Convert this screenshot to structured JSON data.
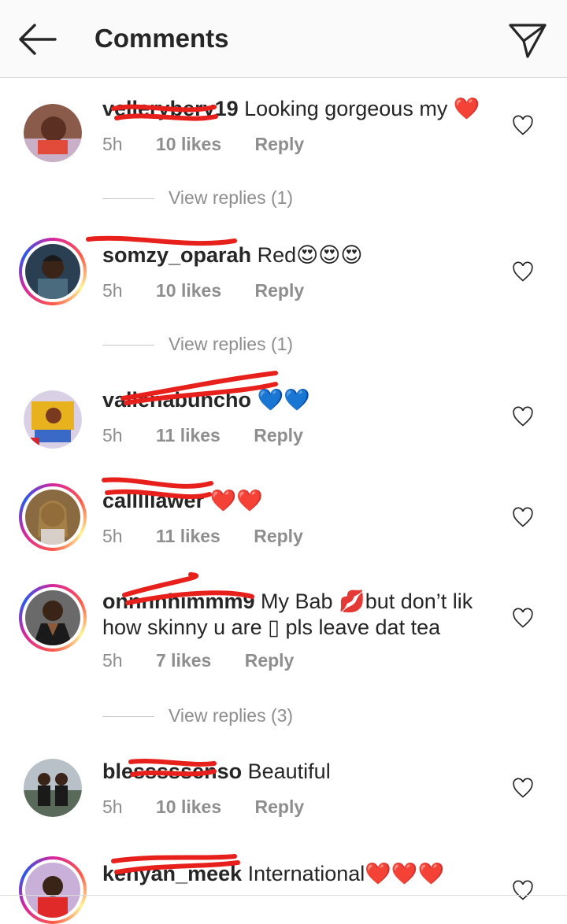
{
  "header": {
    "title": "Comments",
    "icons": {
      "back": "back-arrow-icon",
      "share": "direct-message-icon"
    }
  },
  "comments": [
    {
      "username": "vellerybery19",
      "text": "Looking gorgeous my",
      "emoji": "❤️",
      "time": "5h",
      "likes": "10 likes",
      "reply": "Reply",
      "view_replies": "View replies (1)",
      "story_ring": false
    },
    {
      "username": "somzy_oparah",
      "text": "Red",
      "emoji": "😍😍😍",
      "time": "5h",
      "likes": "10 likes",
      "reply": "Reply",
      "view_replies": "View replies (1)",
      "story_ring": true
    },
    {
      "username": "vallenabuncho",
      "text": "",
      "emoji": "💙💙",
      "time": "5h",
      "likes": "11 likes",
      "reply": "Reply",
      "story_ring": false
    },
    {
      "username": "calllllawer",
      "text": "",
      "emoji": "❤️❤️",
      "time": "5h",
      "likes": "11 likes",
      "reply": "Reply",
      "story_ring": true
    },
    {
      "username": "onnnnhimmm9",
      "text_line1": "My Bab",
      "emoji": "💋",
      "text_line1b": "but don’t lik",
      "text_line2": "how skinny u are ▯ pls leave dat tea",
      "time": "5h",
      "likes": "7 likes",
      "reply": "Reply",
      "view_replies": "View replies (3)",
      "story_ring": true
    },
    {
      "username": "blesssssenso",
      "text": "Beautiful",
      "time": "5h",
      "likes": "10 likes",
      "reply": "Reply",
      "story_ring": false
    },
    {
      "username": "kenyan_meek",
      "text": "International",
      "emoji": "❤️❤️❤️",
      "story_ring": true
    }
  ],
  "colors": {
    "text": "#262626",
    "secondary": "#8e8e8e",
    "redaction": "#e8201c"
  }
}
